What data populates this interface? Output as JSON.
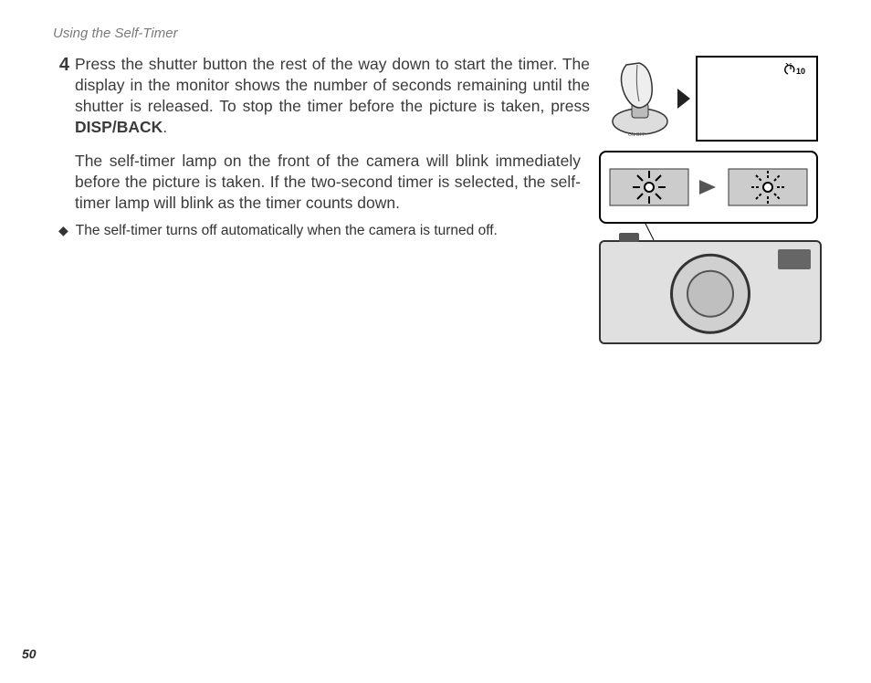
{
  "header": "Using the Self-Timer",
  "step": {
    "number": "4",
    "text_a": "Press the shutter button the rest of the way down to start the timer. The display in the monitor shows the number of seconds remaining until the shutter is released. To stop the timer before the picture is taken, press ",
    "disp_back": "DISP/BACK",
    "text_b": "."
  },
  "monitor": {
    "icon": "10",
    "on_off": "ON  OFF"
  },
  "paragraph": "The self-timer lamp on the front of the camera will blink immediately before the picture is taken. If the two-second timer is selected, the self-timer lamp will blink as the timer counts down.",
  "note": {
    "bullet": "◆",
    "text": "The self-timer turns off automatically when the camera is turned off."
  },
  "page_number": "50"
}
